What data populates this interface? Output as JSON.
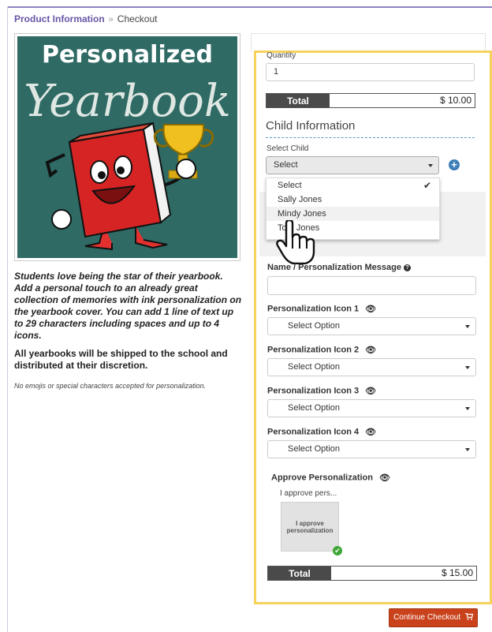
{
  "breadcrumb": {
    "parent": "Product Information",
    "separator": "»",
    "current": "Checkout"
  },
  "product": {
    "image_title": "Personalized",
    "image_subtitle": "Yearbook",
    "description": "Students love being the star of their yearbook. Add a personal touch to an already great collection of memories with ink personalization on the yearbook cover. You can add 1 line of text up to 29 characters including spaces and up to 4 icons.",
    "shipping_note": "All yearbooks will be shipped to the school and distributed at their discretion.",
    "restriction_note": "No emojis or special characters accepted for personalization."
  },
  "order": {
    "quantity_label": "Quantity",
    "quantity_value": "1",
    "total_label": "Total",
    "total_value": "$ 10.00"
  },
  "child": {
    "section_title": "Child Information",
    "select_label": "Select Child",
    "selected": "Select",
    "options": [
      "Select",
      "Sally Jones",
      "Mindy Jones",
      "Tom Jones"
    ],
    "add_icon": "plus-circle-icon"
  },
  "personalization": {
    "message_label": "Name / Personalization Message",
    "message_value": "",
    "icon_slots": [
      {
        "label": "Personalization Icon 1",
        "value": "Select Option"
      },
      {
        "label": "Personalization Icon 2",
        "value": "Select Option"
      },
      {
        "label": "Personalization Icon 3",
        "value": "Select Option"
      },
      {
        "label": "Personalization Icon 4",
        "value": "Select Option"
      }
    ],
    "approve_label": "Approve Personalization",
    "approve_preview": "I approve pers...",
    "approve_tile": "I approve personalization",
    "total_label": "Total",
    "total_value": "$ 15.00"
  },
  "continue_label": "Continue Checkout",
  "colors": {
    "accent": "#6a55a8",
    "highlight": "#f6d25c",
    "button": "#c9421b",
    "add": "#3f7fb8",
    "success": "#3ea635"
  }
}
